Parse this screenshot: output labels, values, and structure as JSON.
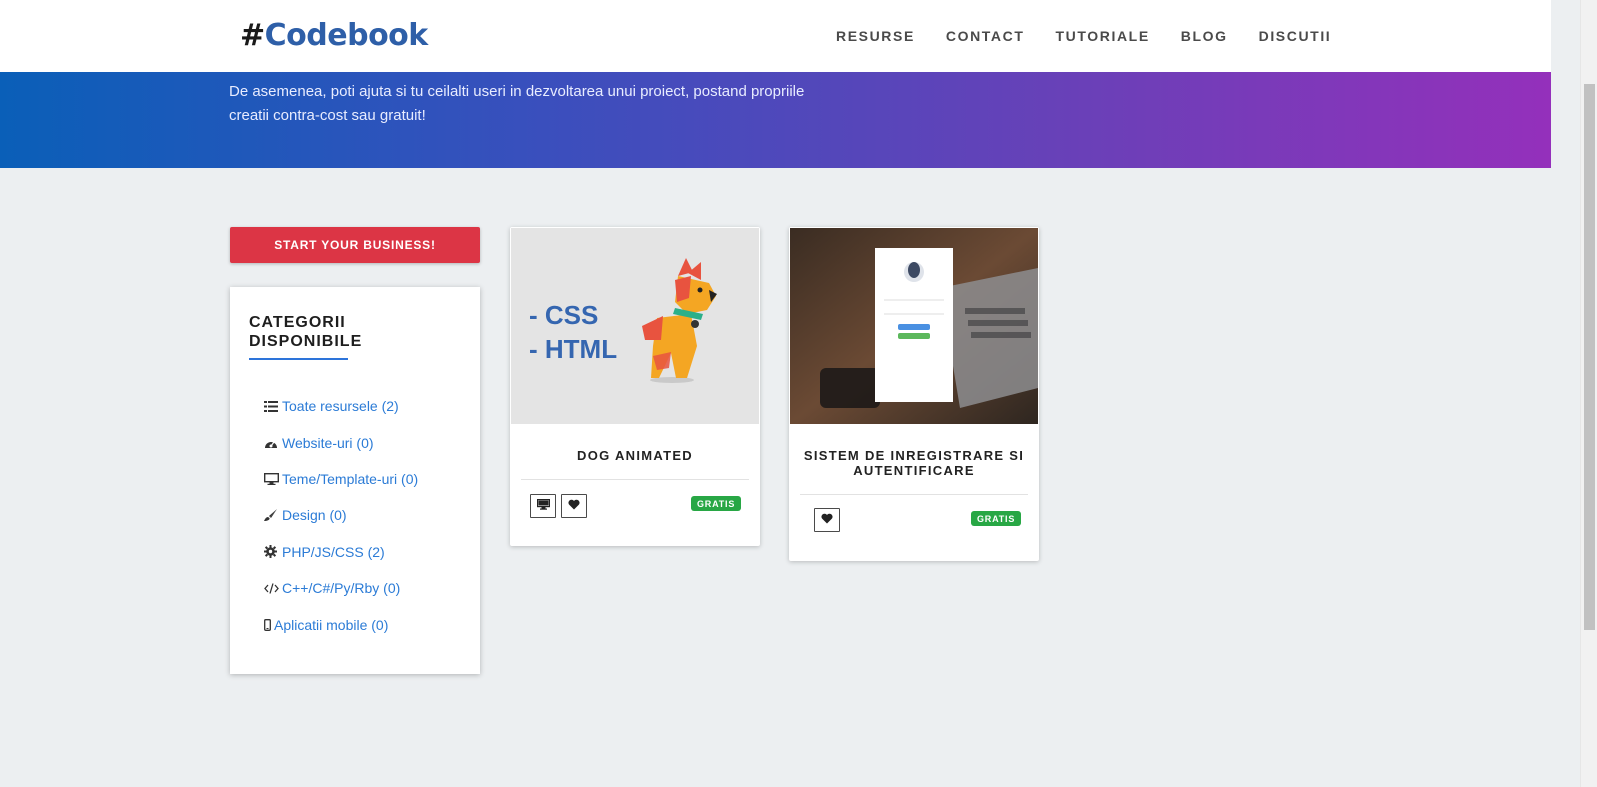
{
  "brand": {
    "hash": "#",
    "name": "Codebook"
  },
  "nav": [
    {
      "label": "RESURSE"
    },
    {
      "label": "CONTACT"
    },
    {
      "label": "TUTORIALE"
    },
    {
      "label": "BLOG"
    },
    {
      "label": "DISCUTII"
    }
  ],
  "hero": {
    "line1": "De asemenea, poti ajuta si tu ceilalti useri in dezvoltarea unui proiect, postand propriile",
    "line2": "creatii contra-cost sau gratuit!"
  },
  "sidebar": {
    "start_button": "START YOUR BUSINESS!",
    "categories_title": "CATEGORII DISPONIBILE",
    "categories": [
      {
        "icon": "list-icon",
        "label": "Toate resursele (2)"
      },
      {
        "icon": "dashboard-icon",
        "label": "Website-uri (0)"
      },
      {
        "icon": "desktop-icon",
        "label": "Teme/Template-uri (0)"
      },
      {
        "icon": "paint-brush-icon",
        "label": "Design (0)"
      },
      {
        "icon": "gear-icon",
        "label": "PHP/JS/CSS (2)"
      },
      {
        "icon": "code-icon",
        "label": "C++/C#/Py/Rby (0)"
      },
      {
        "icon": "mobile-icon",
        "label": "Aplicatii mobile (0)"
      }
    ]
  },
  "cards": [
    {
      "title": "DOG ANIMATED",
      "image_text": [
        "- CSS",
        "- HTML"
      ],
      "badge": "GRATIS"
    },
    {
      "title": "SISTEM DE INREGISTRARE SI AUTENTIFICARE",
      "badge": "GRATIS"
    }
  ],
  "colors": {
    "brand": "#2e5fa8",
    "link": "#2b7bd6",
    "danger": "#dc3545",
    "success": "#28a745",
    "gradient_start": "#0a5fb8",
    "gradient_end": "#9430bb"
  }
}
